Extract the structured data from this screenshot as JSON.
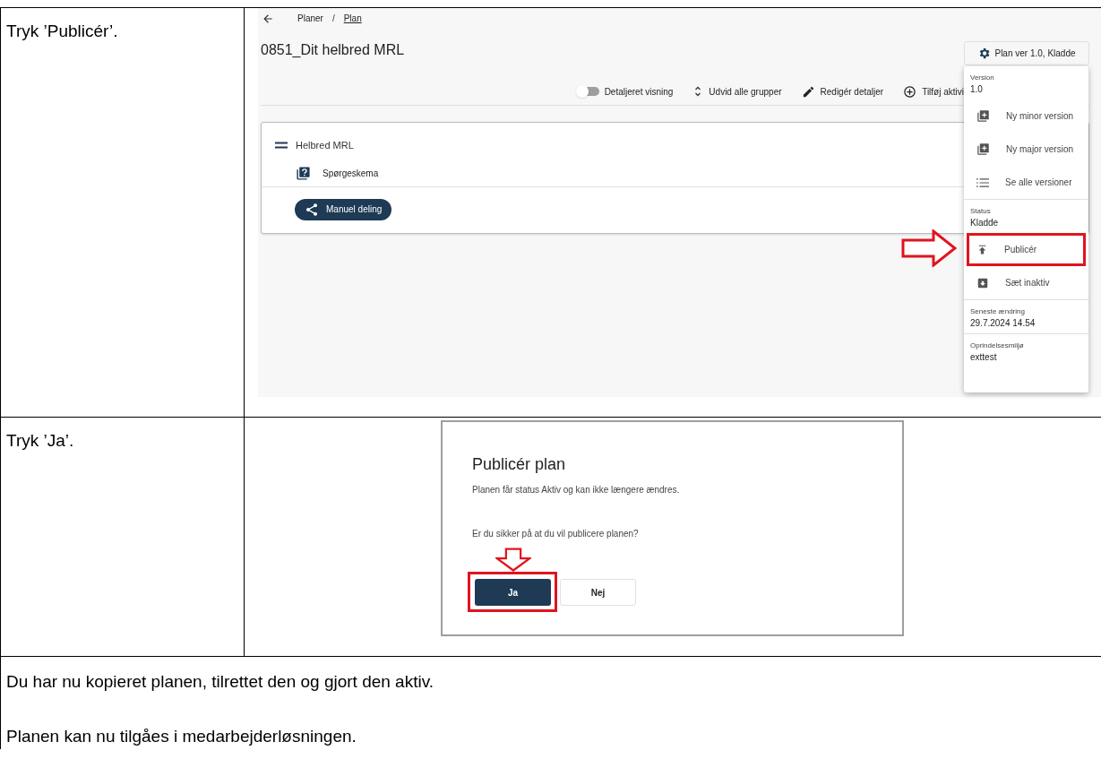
{
  "steps": [
    {
      "instruction": "Tryk ’Publicér’.",
      "screen": {
        "kind": "plan_page",
        "breadcrumb": [
          {
            "label": "Planer",
            "link": false
          },
          {
            "label": "Plan",
            "link": true
          }
        ],
        "breadcrumb_separator": "/",
        "title": "0851_Dit helbred MRL",
        "plan_button": "Plan ver 1.0, Kladde",
        "toolbar": [
          {
            "kind": "toggle",
            "label": "Detaljeret visning",
            "on": false
          },
          {
            "kind": "expand",
            "label": "Udvid alle grupper"
          },
          {
            "kind": "edit",
            "label": "Redigér detaljer"
          },
          {
            "kind": "add",
            "label": "Tilføj aktivi"
          }
        ],
        "card": {
          "title": "Helbred MRL",
          "item": "Spørgeskema",
          "share_button": "Manuel deling"
        },
        "menu": [
          [
            {
              "kind": "info",
              "label": "Version",
              "value": "1.0"
            },
            {
              "kind": "action",
              "label": "Ny minor version",
              "highlighted": false
            },
            {
              "kind": "action",
              "label": "Ny major version",
              "highlighted": false
            },
            {
              "kind": "action",
              "label": "Se alle versioner",
              "highlighted": false
            }
          ],
          [
            {
              "kind": "info",
              "label": "Status",
              "value": "Kladde"
            },
            {
              "kind": "action",
              "label": "Publicér",
              "highlighted": true
            },
            {
              "kind": "action",
              "label": "Sæt inaktiv",
              "highlighted": false
            }
          ],
          [
            {
              "kind": "info",
              "label": "Seneste ændring",
              "value": "29.7.2024 14.54"
            }
          ],
          [
            {
              "kind": "info",
              "label": "Oprindelsesmiljø",
              "value": "exttest"
            }
          ]
        ]
      }
    },
    {
      "instruction": "Tryk ’Ja’.",
      "screen": {
        "kind": "dialog",
        "title": "Publicér plan",
        "message": "Planen får status Aktiv og kan ikke længere ændres.",
        "question": "Er du sikker på at du vil publicere planen?",
        "buttons": [
          {
            "label": "Ja",
            "primary": true,
            "highlighted": true
          },
          {
            "label": "Nej",
            "primary": false,
            "highlighted": false
          }
        ]
      }
    }
  ],
  "conclusion": [
    "Du har nu kopieret planen, tilrettet den og gjort den aktiv.",
    "Planen kan nu tilgåes i medarbejderløsningen."
  ]
}
